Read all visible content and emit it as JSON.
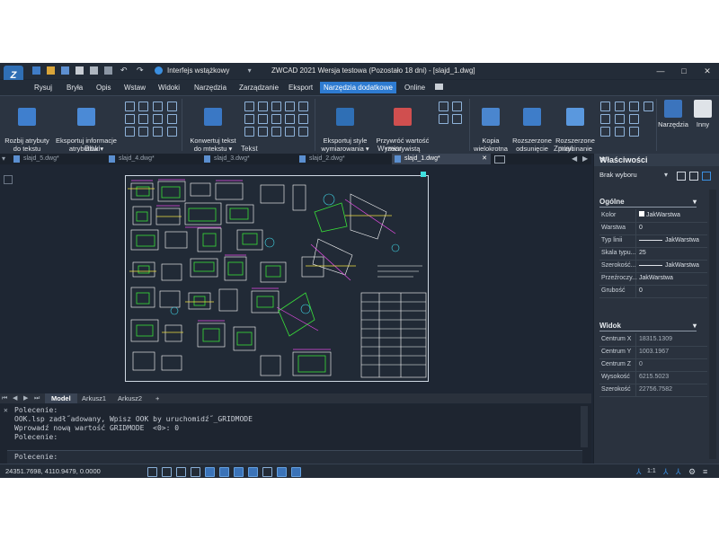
{
  "window": {
    "workspace": "Interfejs wstążkowy",
    "title": "ZWCAD 2021 Wersja testowa (Pozostało 18 dni) - [slajd_1.dwg]",
    "controls": [
      "—",
      "□",
      "✕"
    ]
  },
  "menu": [
    "Rysuj",
    "Bryła",
    "Opis",
    "Wstaw",
    "Widoki",
    "Narzędzia",
    "Zarządzanie",
    "Eksport",
    "Narzędzia dodatkowe",
    "Online"
  ],
  "menu_active": "Narzędzia dodatkowe",
  "ribbon": {
    "bloki": {
      "label": "Bloki",
      "b1": "Rozbij atrybuty\ndo tekstu",
      "b2": "Eksportuj informacje\natrybutów ▾"
    },
    "tekst": {
      "label": "Tekst",
      "b1": "Konwertuj tekst\ndo mtekstu ▾"
    },
    "wymiar": {
      "label": "Wymiar",
      "b1": "Eksportuj style\nwymiarowania ▾",
      "b2": "Przywróć wartość\nrzeczywistą wymiaru"
    },
    "zmien": {
      "label": "Zmień",
      "b1": "Kopia\nwielokrotna",
      "b2": "Rozszerzone\nodsunięcie",
      "b3": "Rozszerzone\nprzycinanie"
    },
    "narzedzia": "Narzędzia",
    "inny": "Inny"
  },
  "doc_tabs": [
    "slajd_5.dwg*",
    "slajd_4.dwg*",
    "slajd_3.dwg*",
    "slajd_2.dwg*",
    "slajd_1.dwg*"
  ],
  "doc_active": "slajd_1.dwg*",
  "layout_tabs": [
    "Model",
    "Arkusz1",
    "Arkusz2",
    "+"
  ],
  "command_lines": [
    "Polecenie:",
    "OOK.lsp zadł˝adowany, Wpisz OOK by uruchomidź˝_GRIDMODE",
    "Wprowadź nową wartość GRIDMODE  <0>: 0",
    "Polecenie:"
  ],
  "command_prompt": "Polecenie:",
  "status": {
    "coords": "24351.7698, 4110.9479, 0.0000",
    "scale": "1:1"
  },
  "properties": {
    "title": "Właściwości",
    "selection": "Brak wyboru",
    "ogolne": "Ogólne",
    "rows": [
      {
        "label": "Kolor",
        "value": "JakWarstwa"
      },
      {
        "label": "Warstwa",
        "value": "0"
      },
      {
        "label": "Typ linii",
        "value": "JakWarstwa"
      },
      {
        "label": "Skala typu...",
        "value": "25"
      },
      {
        "label": "Szerokość...",
        "value": "JakWarstwa"
      },
      {
        "label": "Przeźroczy...",
        "value": "JakWarstwa"
      },
      {
        "label": "Grubość",
        "value": "0"
      }
    ],
    "widok": "Widok",
    "view_rows": [
      {
        "label": "Centrum X",
        "value": "18315.1309"
      },
      {
        "label": "Centrum Y",
        "value": "1003.1967"
      },
      {
        "label": "Centrum Z",
        "value": "0"
      },
      {
        "label": "Wysokość",
        "value": "6215.5023"
      },
      {
        "label": "Szerokość",
        "value": "22756.7582"
      }
    ]
  },
  "colors": {
    "accent": "#2e7bd1",
    "background": "#1e2633",
    "ribbon": "#2b3441"
  }
}
